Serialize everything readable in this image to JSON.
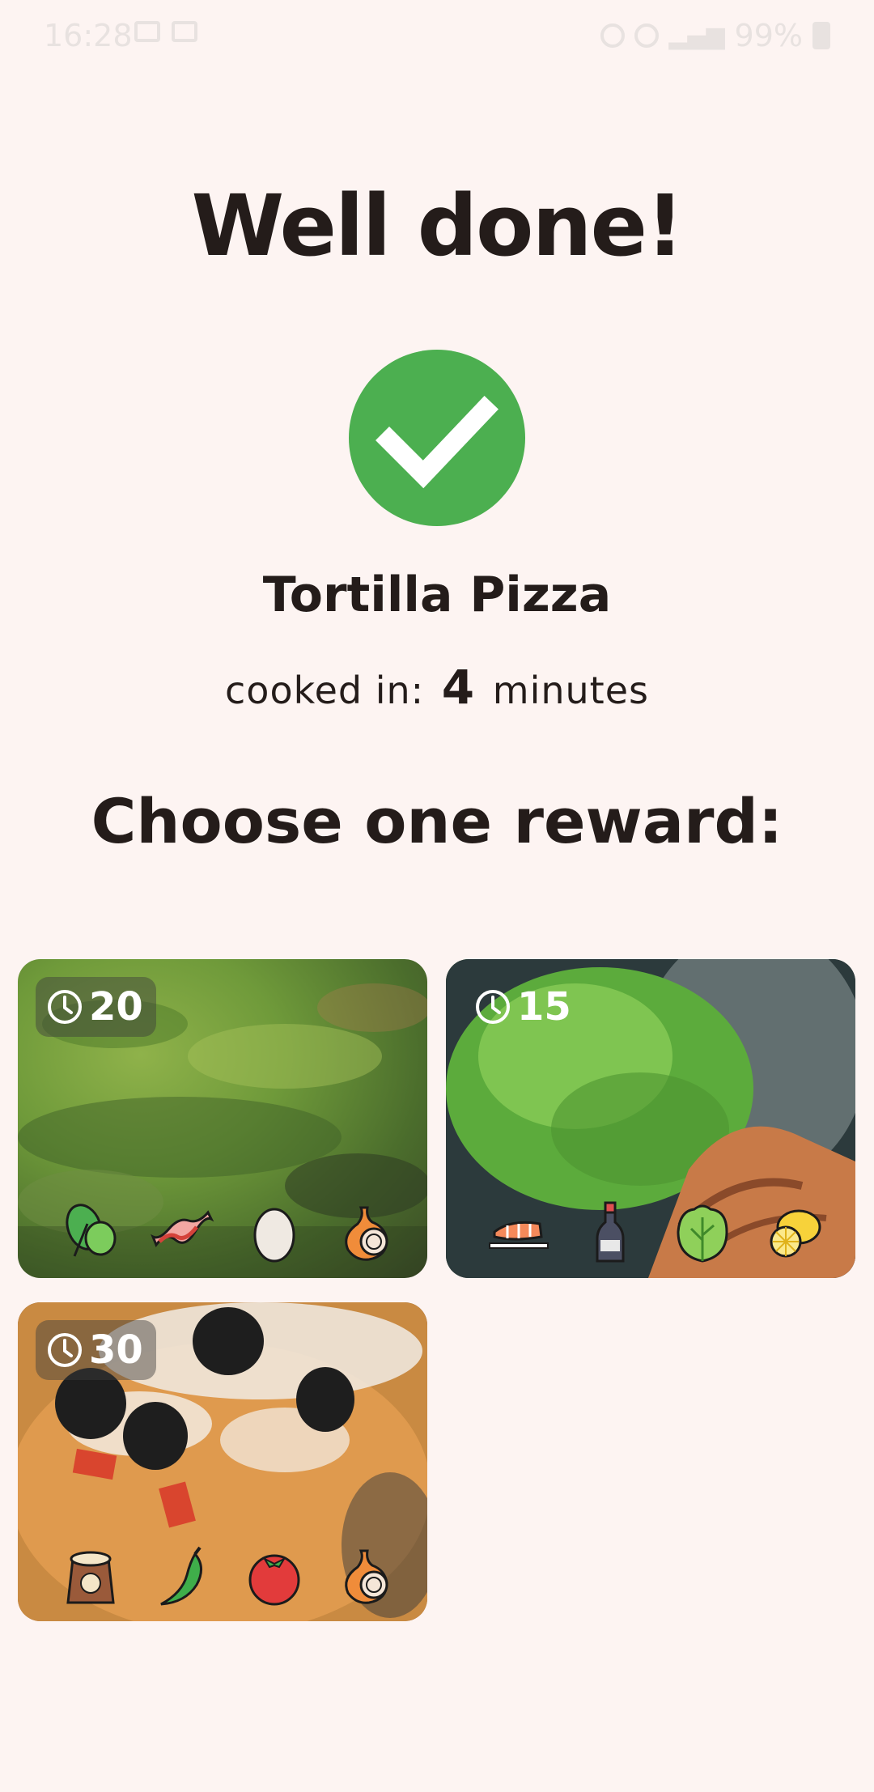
{
  "status_bar": {
    "time": "16:28",
    "battery": "99%"
  },
  "header": {
    "title": "Well done!"
  },
  "result": {
    "recipe_name": "Tortilla Pizza",
    "cooked_prefix": "cooked in:",
    "cooked_value": "4",
    "cooked_unit": "minutes"
  },
  "rewards": {
    "heading": "Choose one reward:",
    "items": [
      {
        "minutes": "20",
        "ingredients": [
          "spinach-icon",
          "bacon-icon",
          "egg-icon",
          "onion-icon"
        ]
      },
      {
        "minutes": "15",
        "ingredients": [
          "salmon-icon",
          "soy-sauce-icon",
          "lettuce-icon",
          "lemon-icon"
        ]
      },
      {
        "minutes": "30",
        "ingredients": [
          "flour-sack-icon",
          "chili-pepper-icon",
          "tomato-icon",
          "onion-icon"
        ]
      }
    ]
  },
  "colors": {
    "background": "#fdf4f2",
    "success": "#4caf50",
    "text": "#241c1a"
  }
}
